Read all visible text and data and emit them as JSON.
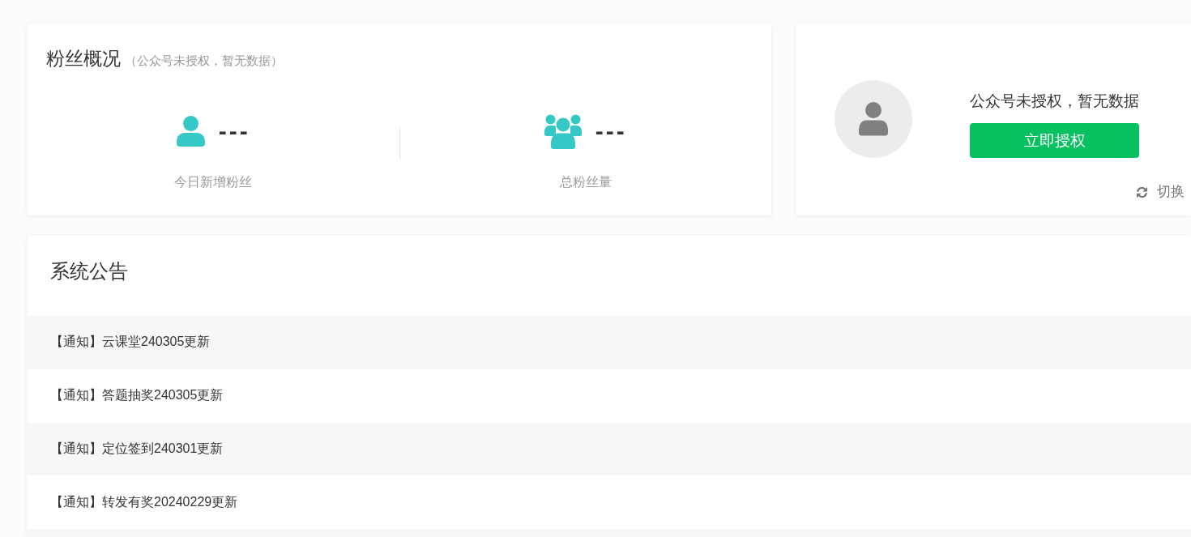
{
  "fans_overview": {
    "title": "粉丝概况",
    "note": "（公众号未授权，暂无数据）",
    "stats": [
      {
        "kind": "single",
        "value": "---",
        "label": "今日新增粉丝"
      },
      {
        "kind": "group",
        "value": "---",
        "label": "总粉丝量"
      }
    ]
  },
  "account": {
    "message": "公众号未授权，暂无数据",
    "button": "立即授权",
    "switch": "切换"
  },
  "announcements": {
    "title": "系统公告",
    "items": [
      "【通知】云课堂240305更新",
      "【通知】答题抽奖240305更新",
      "【通知】定位签到240301更新",
      "【通知】转发有奖20240229更新"
    ]
  }
}
